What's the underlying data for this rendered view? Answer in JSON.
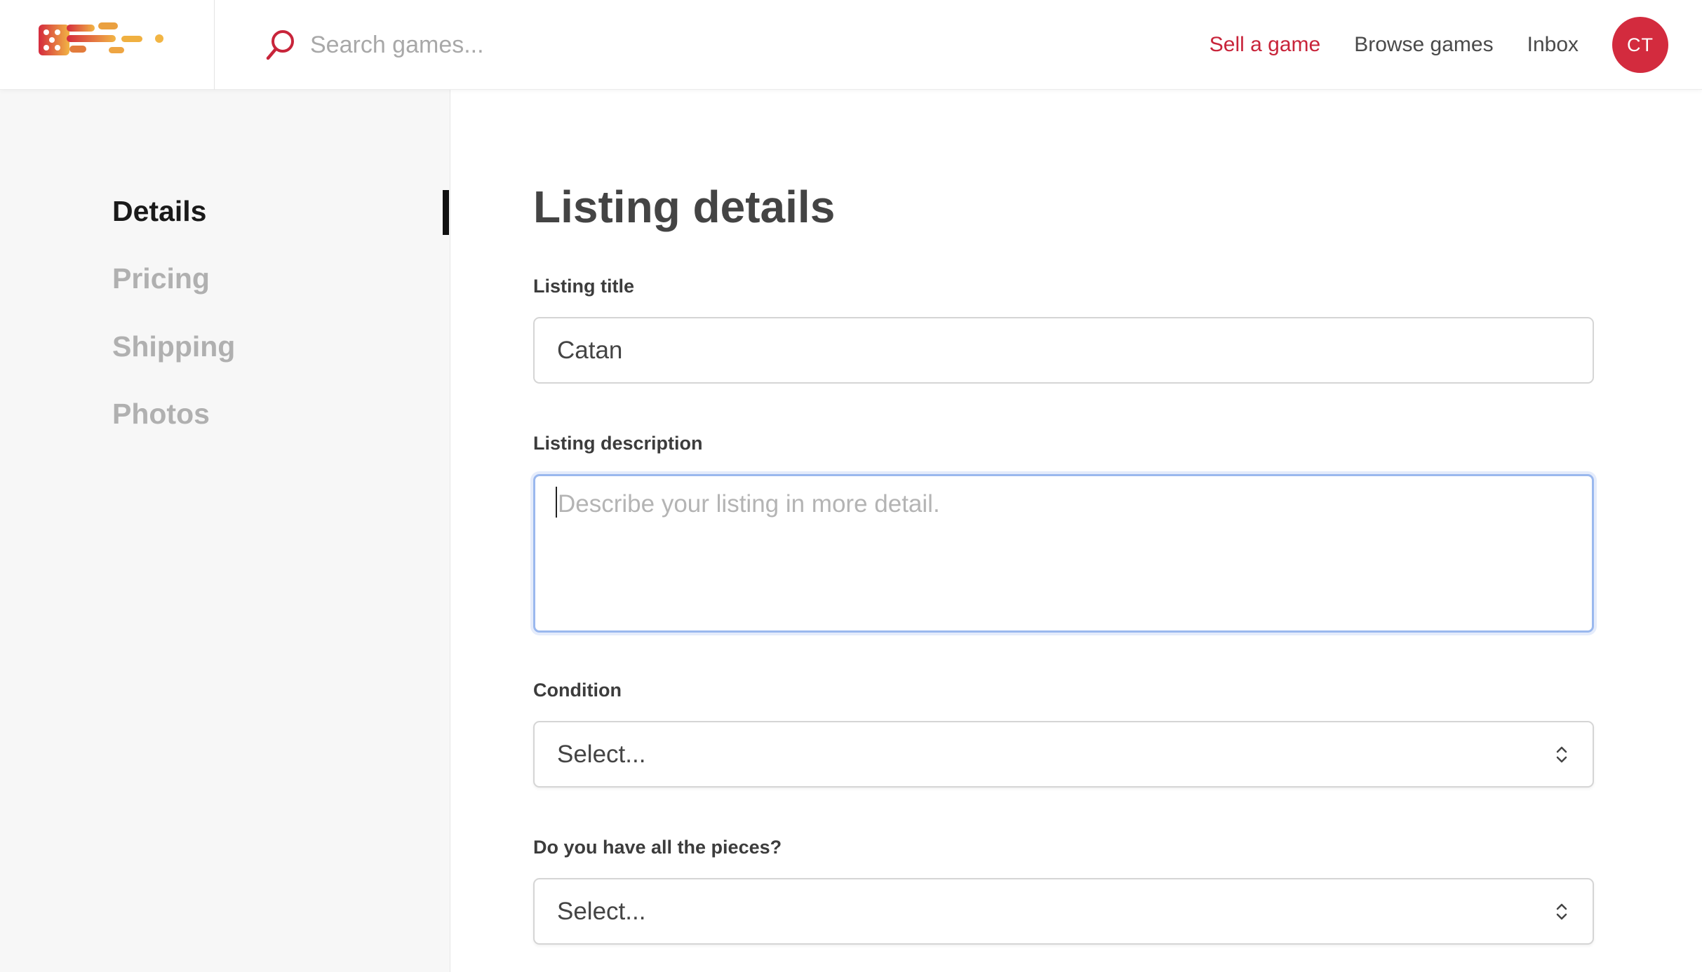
{
  "header": {
    "logo_name": "dice-speed-logo",
    "search": {
      "placeholder": "Search games..."
    },
    "nav": {
      "sell": "Sell a game",
      "browse": "Browse games",
      "inbox": "Inbox"
    },
    "avatar_initials": "CT"
  },
  "sidebar": {
    "items": [
      {
        "label": "Details",
        "active": true
      },
      {
        "label": "Pricing",
        "active": false
      },
      {
        "label": "Shipping",
        "active": false
      },
      {
        "label": "Photos",
        "active": false
      }
    ]
  },
  "form": {
    "title": "Listing details",
    "listing_title": {
      "label": "Listing title",
      "value": "Catan"
    },
    "listing_description": {
      "label": "Listing description",
      "placeholder": "Describe your listing in more detail."
    },
    "condition": {
      "label": "Condition",
      "value": "Select..."
    },
    "all_pieces": {
      "label": "Do you have all the pieces?",
      "value": "Select..."
    }
  },
  "colors": {
    "accent": "#c8243a",
    "avatar": "#d32b3e",
    "focus_border": "#9ab8ee",
    "sidebar_bg": "#f7f7f7"
  }
}
